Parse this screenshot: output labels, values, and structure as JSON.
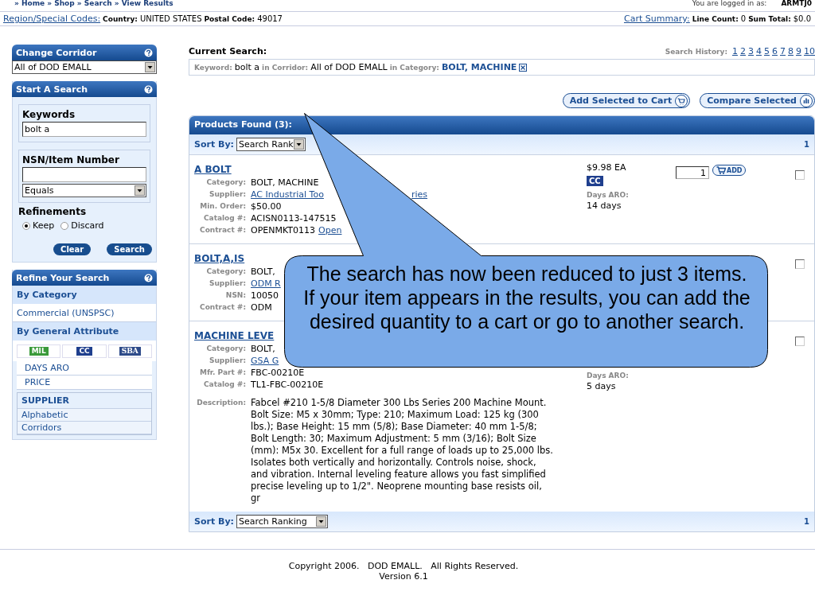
{
  "breadcrumb": "» Home » Shop » Search » View Results",
  "login": {
    "label": "You are logged in as:",
    "user": "ARMTJ0"
  },
  "region": {
    "link": "Region/Special Codes:",
    "country_label": "Country:",
    "country": "UNITED STATES",
    "postal_label": "Postal Code:",
    "postal": "49017"
  },
  "cart": {
    "link": "Cart Summary:",
    "line_label": "Line Count:",
    "line": "0",
    "sum_label": "Sum Total:",
    "sum": "$0.0"
  },
  "sidebar": {
    "corridor": {
      "title": "Change Corridor",
      "value": "All of DOD EMALL"
    },
    "search": {
      "title": "Start A Search",
      "keywords_label": "Keywords",
      "keywords": "bolt a",
      "nsn_label": "NSN/Item Number",
      "match": "Equals",
      "refinements_label": "Refinements",
      "options": [
        {
          "label": "Keep",
          "selected": true
        },
        {
          "label": "Discard",
          "selected": false
        }
      ],
      "buttons": [
        "Clear",
        "Search"
      ]
    },
    "refine": {
      "title": "Refine Your Search",
      "items": [
        {
          "kind": "heading",
          "label": "By Category"
        },
        {
          "kind": "link",
          "label": "Commercial (UNSPSC)"
        },
        {
          "kind": "heading",
          "label": "By General Attribute"
        },
        {
          "kind": "badges",
          "labels": [
            "MIL",
            "CC",
            "SBA"
          ]
        },
        {
          "kind": "link",
          "label": "DAYS ARO"
        },
        {
          "kind": "link",
          "label": "PRICE"
        },
        {
          "kind": "group",
          "label": "SUPPLIER",
          "links": [
            "Alphabetic",
            "Corridors"
          ]
        }
      ]
    }
  },
  "current_search": {
    "title": "Current Search:",
    "history_label": "Search History:",
    "history": [
      "1",
      "2",
      "3",
      "4",
      "5",
      "6",
      "7",
      "8",
      "9",
      "10"
    ],
    "keyword_label": "Keyword:",
    "keyword": "bolt a",
    "corridor_label": "in Corridor:",
    "corridor": "All of DOD EMALL",
    "category_label": "in Category:",
    "category": "BOLT, MACHINE"
  },
  "actions": [
    "Add Selected to Cart",
    "Compare Selected"
  ],
  "results": {
    "title": "Products Found (3):",
    "sort_label": "Sort By:",
    "sort": "Search Rank",
    "page": "1",
    "bottom_sort_label": "Sort By:",
    "bottom_sort": "Search Ranking",
    "bottom_page": "1",
    "products": [
      {
        "title": "A BOLT",
        "checked": false,
        "fields": [
          {
            "label": "Category:",
            "value": "BOLT, MACHINE"
          },
          {
            "label": "Supplier:",
            "link": "AC Industrial Too",
            "tail": "ries"
          },
          {
            "label": "Min. Order:",
            "value": "$50.00"
          },
          {
            "label": "Catalog #:",
            "value": "ACISN0113-147515"
          },
          {
            "label": "Contract #:",
            "value": "OPENMKT0113",
            "link": "Open"
          }
        ],
        "price": "$9.98 EA",
        "badge": "CC",
        "qty": "1",
        "add": "ADD",
        "days_label": "Days ARO:",
        "days": "14 days"
      },
      {
        "title": "BOLT,A,IS",
        "checked": false,
        "fields": [
          {
            "label": "Category:",
            "value": "BOLT,"
          },
          {
            "label": "Supplier:",
            "link": "ODM R"
          },
          {
            "label": "NSN:",
            "value": "10050"
          },
          {
            "label": "Contract #:",
            "value": "ODM"
          }
        ]
      },
      {
        "title": "MACHINE LEVE",
        "checked": false,
        "fields": [
          {
            "label": "Category:",
            "value": "BOLT,"
          },
          {
            "label": "Supplier:",
            "link": "GSA G"
          },
          {
            "label": "Mfr. Part #:",
            "value": "FBC-00210E"
          },
          {
            "label": "Catalog #:",
            "value": "TL1-FBC-00210E"
          }
        ],
        "days_label": "Days ARO:",
        "days": "5 days",
        "description_label": "Description:",
        "description": "Fabcel #210 1-5/8 Diameter 300 Lbs Series 200 Machine Mount. Bolt Size: M5 x 30mm; Type: 210; Maximum Load: 125 kg (300 lbs.); Base Height: 15 mm (5/8); Base Diameter: 40 mm 1-5/8; Bolt Length: 30; Maximum Adjustment: 5 mm (3/16); Bolt Size (mm): M5x 30. Excellent for a full range of loads up to 25,000 lbs. Isolates both vertically and horizontally. Controls noise, shock, and vibration. Internal leveling feature allows you fast simplified precise leveling up to 1/2\". Neoprene mounting base resists oil, gr"
      }
    ]
  },
  "footer": {
    "copyright": "Copyright 2006.   DOD EMALL.   All Rights Reserved.",
    "version": "Version 6.1"
  },
  "callout": "The search has now been reduced to just 3 items. If your item appears in the results, you can add the desired quantity to a cart or go to another search."
}
